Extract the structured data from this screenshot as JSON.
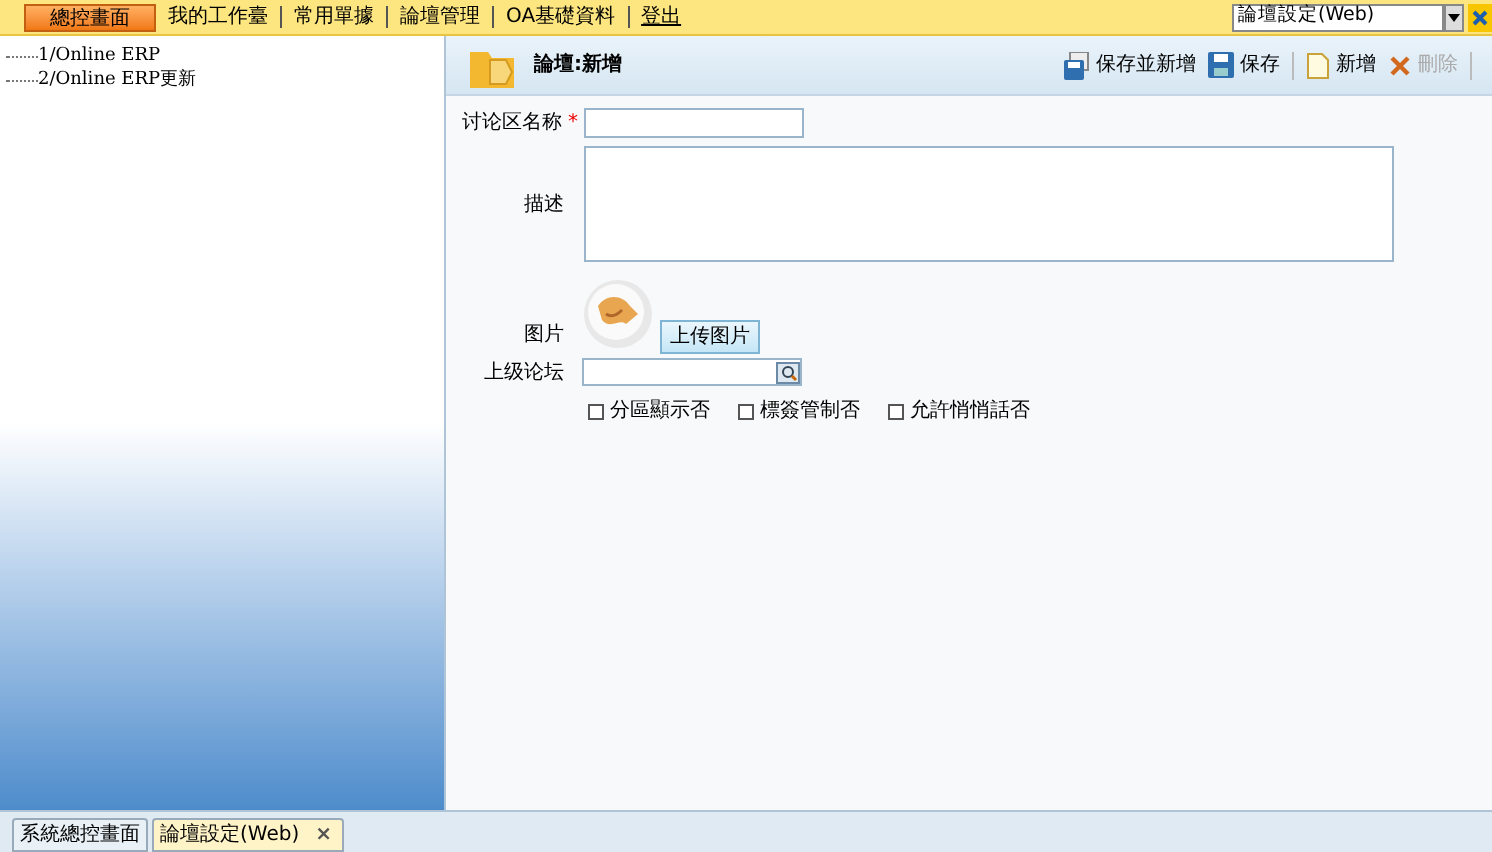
{
  "top_nav": {
    "items": [
      {
        "label": "總控畫面",
        "selected": true
      },
      {
        "label": "我的工作臺",
        "selected": false
      },
      {
        "label": "常用單據",
        "selected": false
      },
      {
        "label": "論壇管理",
        "selected": false
      },
      {
        "label": "OA基礎資料",
        "selected": false
      },
      {
        "label": "登出",
        "selected": false,
        "kind": "link"
      }
    ],
    "module_select": {
      "value": "論壇設定(Web)"
    }
  },
  "sidebar": {
    "items": [
      {
        "label": "1/Online ERP"
      },
      {
        "label": "2/Online ERP更新"
      }
    ]
  },
  "panel": {
    "title": "論壇:新增",
    "toolbar": [
      {
        "label": "保存並新增",
        "kind": "save-new",
        "disabled": false
      },
      {
        "label": "保存",
        "kind": "save",
        "disabled": false
      },
      {
        "label": "新增",
        "kind": "new",
        "disabled": false
      },
      {
        "label": "刪除",
        "kind": "delete",
        "disabled": true
      }
    ],
    "form": {
      "name_label": "讨论区名称",
      "required_mark": "*",
      "description_label": "描述",
      "image_label": "图片",
      "upload_button": "上传图片",
      "parent_label": "上级论坛",
      "checkboxes": [
        {
          "label": "分區顯示否",
          "checked": false
        },
        {
          "label": "標簽管制否",
          "checked": false
        },
        {
          "label": "允許悄悄話否",
          "checked": false
        }
      ]
    }
  },
  "bottom_tabs": [
    {
      "label": "系統總控畫面",
      "selected": false
    },
    {
      "label": "論壇設定(Web)",
      "selected": true,
      "close": "×"
    }
  ]
}
